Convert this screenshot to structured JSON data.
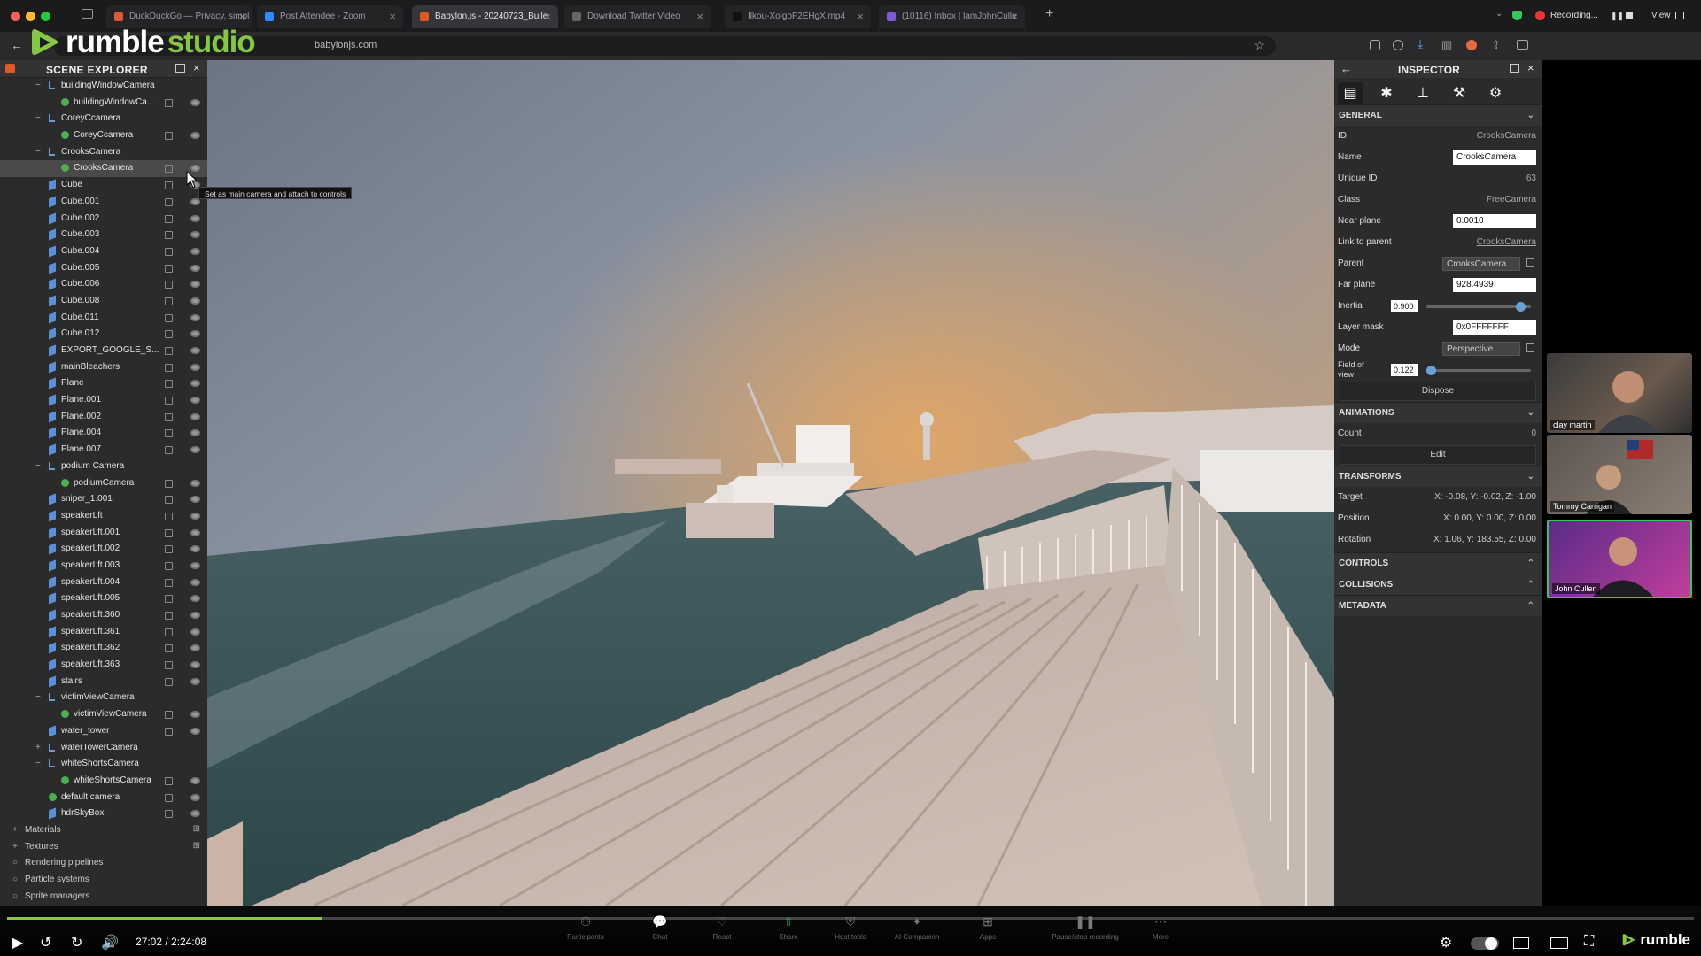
{
  "browser": {
    "tabs": [
      {
        "label": "DuckDuckGo — Privacy, simpl",
        "color": "#de5833"
      },
      {
        "label": "Post Attendee - Zoom",
        "color": "#2d8cff"
      },
      {
        "label": "Babylon.js - 20240723_Buile",
        "color": "#e25822"
      },
      {
        "label": "Download Twitter Video",
        "color": "#666666"
      },
      {
        "label": "Ilkou-XolgoF2EHgX.mp4",
        "color": "#111111"
      },
      {
        "label": "(10116) Inbox | lamJohnCulle",
        "color": "#7b5cd6"
      }
    ],
    "url": "babylonjs.com",
    "recording_label": "Recording...",
    "view_label": "View"
  },
  "watermark": {
    "rumble": "rumble",
    "studio": "studio"
  },
  "explorer": {
    "title": "SCENE EXPLORER",
    "tooltip": "Set as main camera and attach to controls",
    "rows": [
      {
        "label": "buildingWindowCamera",
        "indent": 1,
        "type": "node",
        "expand": "−"
      },
      {
        "label": "buildingWindowCa...",
        "indent": 2,
        "type": "camera"
      },
      {
        "label": "CoreyCcamera",
        "indent": 1,
        "type": "node",
        "expand": "−"
      },
      {
        "label": "CoreyCcamera",
        "indent": 2,
        "type": "camera"
      },
      {
        "label": "CrooksCamera",
        "indent": 1,
        "type": "node",
        "expand": "−"
      },
      {
        "label": "CrooksCamera",
        "indent": 2,
        "type": "camera",
        "selected": true
      },
      {
        "label": "Cube",
        "indent": 1,
        "type": "mesh"
      },
      {
        "label": "Cube.001",
        "indent": 1,
        "type": "mesh"
      },
      {
        "label": "Cube.002",
        "indent": 1,
        "type": "mesh"
      },
      {
        "label": "Cube.003",
        "indent": 1,
        "type": "mesh"
      },
      {
        "label": "Cube.004",
        "indent": 1,
        "type": "mesh"
      },
      {
        "label": "Cube.005",
        "indent": 1,
        "type": "mesh"
      },
      {
        "label": "Cube.006",
        "indent": 1,
        "type": "mesh"
      },
      {
        "label": "Cube.008",
        "indent": 1,
        "type": "mesh"
      },
      {
        "label": "Cube.011",
        "indent": 1,
        "type": "mesh"
      },
      {
        "label": "Cube.012",
        "indent": 1,
        "type": "mesh"
      },
      {
        "label": "EXPORT_GOOGLE_S...",
        "indent": 1,
        "type": "mesh"
      },
      {
        "label": "mainBleachers",
        "indent": 1,
        "type": "mesh"
      },
      {
        "label": "Plane",
        "indent": 1,
        "type": "mesh"
      },
      {
        "label": "Plane.001",
        "indent": 1,
        "type": "mesh"
      },
      {
        "label": "Plane.002",
        "indent": 1,
        "type": "mesh"
      },
      {
        "label": "Plane.004",
        "indent": 1,
        "type": "mesh"
      },
      {
        "label": "Plane.007",
        "indent": 1,
        "type": "mesh"
      },
      {
        "label": "podium Camera",
        "indent": 1,
        "type": "node",
        "expand": "−"
      },
      {
        "label": "podiumCamera",
        "indent": 2,
        "type": "camera"
      },
      {
        "label": "sniper_1.001",
        "indent": 1,
        "type": "mesh"
      },
      {
        "label": "speakerLft",
        "indent": 1,
        "type": "mesh"
      },
      {
        "label": "speakerLft.001",
        "indent": 1,
        "type": "mesh"
      },
      {
        "label": "speakerLft.002",
        "indent": 1,
        "type": "mesh"
      },
      {
        "label": "speakerLft.003",
        "indent": 1,
        "type": "mesh"
      },
      {
        "label": "speakerLft.004",
        "indent": 1,
        "type": "mesh"
      },
      {
        "label": "speakerLft.005",
        "indent": 1,
        "type": "mesh"
      },
      {
        "label": "speakerLft.360",
        "indent": 1,
        "type": "mesh"
      },
      {
        "label": "speakerLft.361",
        "indent": 1,
        "type": "mesh"
      },
      {
        "label": "speakerLft.362",
        "indent": 1,
        "type": "mesh"
      },
      {
        "label": "speakerLft.363",
        "indent": 1,
        "type": "mesh"
      },
      {
        "label": "stairs",
        "indent": 1,
        "type": "mesh"
      },
      {
        "label": "victimViewCamera",
        "indent": 1,
        "type": "node",
        "expand": "−"
      },
      {
        "label": "victimViewCamera",
        "indent": 2,
        "type": "camera"
      },
      {
        "label": "water_tower",
        "indent": 1,
        "type": "mesh"
      },
      {
        "label": "waterTowerCamera",
        "indent": 1,
        "type": "node",
        "expand": "+"
      },
      {
        "label": "whiteShortsCamera",
        "indent": 1,
        "type": "node",
        "expand": "−"
      },
      {
        "label": "whiteShortsCamera",
        "indent": 2,
        "type": "camera"
      },
      {
        "label": "default camera",
        "indent": 1,
        "type": "camera"
      },
      {
        "label": "hdrSkyBox",
        "indent": 1,
        "type": "mesh"
      }
    ],
    "sections": [
      "Materials",
      "Textures",
      "Rendering pipelines",
      "Particle systems",
      "Sprite managers"
    ]
  },
  "inspector": {
    "title": "INSPECTOR",
    "general": {
      "header": "GENERAL",
      "id_label": "ID",
      "id_value": "CrooksCamera",
      "name_label": "Name",
      "name_value": "CrooksCamera",
      "uid_label": "Unique ID",
      "uid_value": "63",
      "class_label": "Class",
      "class_value": "FreeCamera",
      "near_label": "Near plane",
      "near_value": "0.0010",
      "link_label": "Link to parent",
      "link_value": "CrooksCamera",
      "parent_label": "Parent",
      "parent_value": "CrooksCamera",
      "far_label": "Far plane",
      "far_value": "928.4939",
      "inertia_label": "Inertia",
      "inertia_value": "0.900",
      "inertia_level": 0.9,
      "layer_label": "Layer mask",
      "layer_value": "0x0FFFFFFF",
      "mode_label": "Mode",
      "mode_value": "Perspective",
      "fov_label": "Field of view",
      "fov_value": "0.122",
      "fov_level": 0.04,
      "dispose_label": "Dispose"
    },
    "animations": {
      "header": "ANIMATIONS",
      "count_label": "Count",
      "count_value": "0",
      "edit_label": "Edit"
    },
    "transforms": {
      "header": "TRANSFORMS",
      "target_label": "Target",
      "target_value": "X: -0.08, Y: -0.02, Z: -1.00",
      "position_label": "Position",
      "position_value": "X: 0.00, Y: 0.00, Z: 0.00",
      "rotation_label": "Rotation",
      "rotation_value": "X: 1.06, Y: 183.55, Z: 0.00"
    },
    "controls_header": "CONTROLS",
    "collisions_header": "COLLISIONS",
    "metadata_header": "METADATA"
  },
  "webcams": [
    {
      "name": "clay martin"
    },
    {
      "name": "Tommy Carrigan"
    },
    {
      "name": "John Cullen"
    }
  ],
  "player": {
    "time": "27:02 / 2:24:08",
    "progress": 0.187,
    "brand": "rumble",
    "zoom_tools": [
      "Participants",
      "Chat",
      "React",
      "Share",
      "Host tools",
      "AI Companion",
      "Apps",
      "Pause/stop recording",
      "More"
    ]
  },
  "colors": {
    "accent": "#85c742",
    "zoom_green": "#34c759",
    "slider_blue": "#67a1d8"
  }
}
